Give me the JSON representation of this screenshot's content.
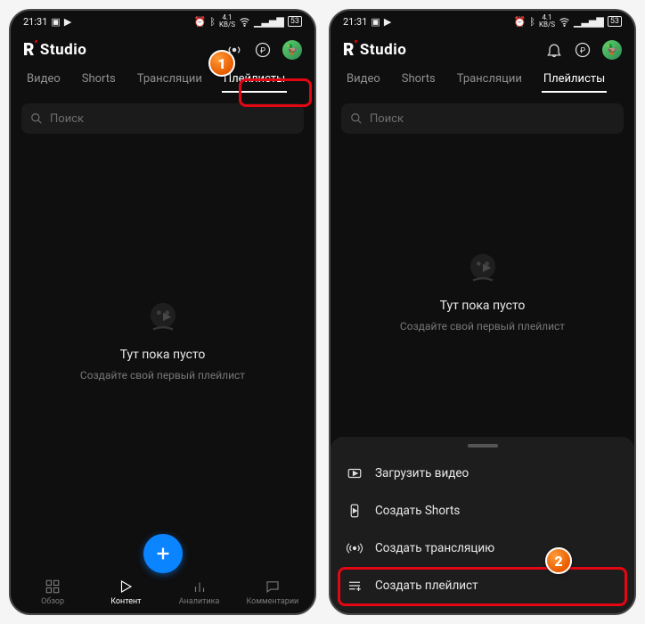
{
  "statusbar": {
    "time": "21:31",
    "icons_left": [
      "camera",
      "youtube",
      "search"
    ],
    "icons_right": [
      "alarm",
      "bluetooth",
      "speed",
      "wifi",
      "signal",
      "battery"
    ],
    "speed_label": "4.1",
    "speed_unit": "KB/S",
    "battery_label": "53"
  },
  "app": {
    "logo_r": "R",
    "logo_rest": "Studio"
  },
  "header_actions": {
    "bell": "bell",
    "ruble": "₽",
    "signal": "signal"
  },
  "tabs": {
    "items": [
      {
        "label": "Видео"
      },
      {
        "label": "Shorts"
      },
      {
        "label": "Трансляции"
      },
      {
        "label": "Плейлисты"
      }
    ],
    "active_index": 3
  },
  "search": {
    "placeholder": "Поиск"
  },
  "empty": {
    "title": "Тут пока пусто",
    "subtitle": "Создайте свой первый плейлист"
  },
  "bottomnav": {
    "items": [
      {
        "label": "Обзор"
      },
      {
        "label": "Контент"
      },
      {
        "label": "Аналитика"
      },
      {
        "label": "Комментарии"
      }
    ],
    "active_index": 1
  },
  "sheet": {
    "items": [
      {
        "label": "Загрузить видео"
      },
      {
        "label": "Создать Shorts"
      },
      {
        "label": "Создать трансляцию"
      },
      {
        "label": "Создать плейлист"
      }
    ]
  },
  "annotations": {
    "badge1": "1",
    "badge2": "2"
  }
}
